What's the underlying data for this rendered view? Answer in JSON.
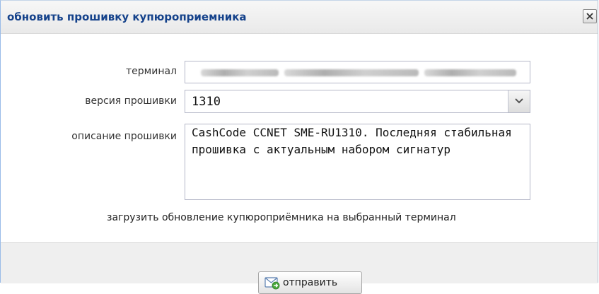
{
  "dialog": {
    "title": "обновить прошивку купюроприемника"
  },
  "form": {
    "terminal_label": "терминал",
    "version_label": "версия прошивки",
    "version_value": "1310",
    "description_label": "описание прошивки",
    "description_value": "CashCode CCNET SME-RU1310. Последняя стабильная прошивка с актуальным набором сигнатур",
    "hint": "загрузить обновление купюроприёмника на выбранный терминал"
  },
  "footer": {
    "send_label": "отправить"
  },
  "icons": {
    "close": "close-icon",
    "dropdown": "chevron-down-icon",
    "send": "mail-send-icon"
  },
  "colors": {
    "title_text": "#15428b",
    "field_border": "#b5b8c8"
  }
}
